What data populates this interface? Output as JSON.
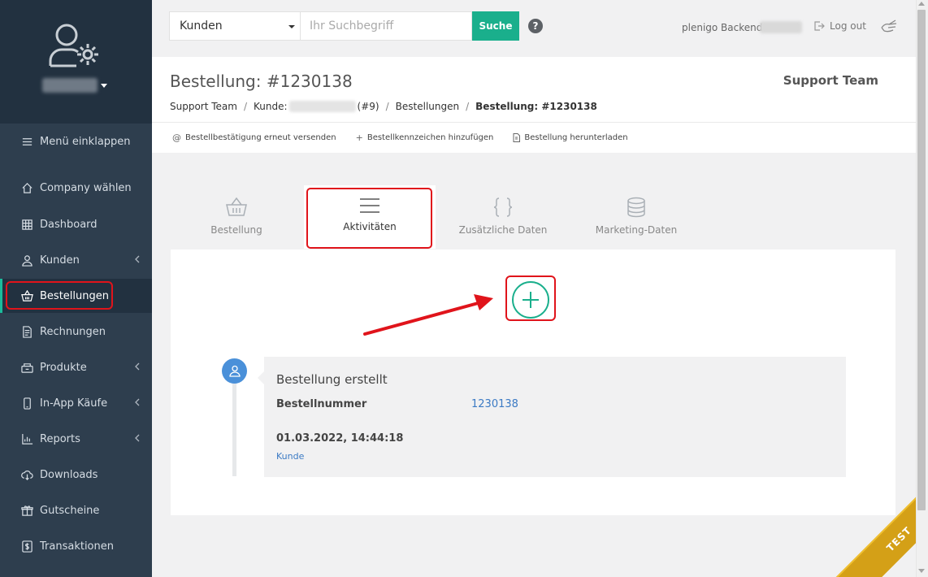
{
  "sidebar": {
    "collapse_label": "Menü einklappen",
    "items": [
      {
        "label": "Company wählen",
        "icon": "home-icon"
      },
      {
        "label": "Dashboard",
        "icon": "grid-icon"
      },
      {
        "label": "Kunden",
        "icon": "user-icon"
      },
      {
        "label": "Bestellungen",
        "icon": "basket-icon"
      },
      {
        "label": "Rechnungen",
        "icon": "document-icon"
      },
      {
        "label": "Produkte",
        "icon": "box-icon"
      },
      {
        "label": "In-App Käufe",
        "icon": "phone-icon"
      },
      {
        "label": "Reports",
        "icon": "bar-chart-icon"
      },
      {
        "label": "Downloads",
        "icon": "cloud-download-icon"
      },
      {
        "label": "Gutscheine",
        "icon": "gift-icon"
      },
      {
        "label": "Transaktionen",
        "icon": "dollar-icon"
      }
    ]
  },
  "topbar": {
    "search_scope": "Kunden",
    "search_placeholder": "Ihr Suchbegriff",
    "search_button": "Suche",
    "help": "?",
    "backend_label": "plenigo Backend",
    "logout_label": "Log out"
  },
  "header": {
    "title": "Bestellung: #1230138",
    "team": "Support Team",
    "breadcrumb": {
      "root": "Support Team",
      "customer_prefix": "Kunde:",
      "customer_suffix": "(#9)",
      "orders": "Bestellungen",
      "current": "Bestellung: #1230138"
    },
    "actions": [
      {
        "label": "Bestellbestätigung erneut versenden",
        "icon": "at-icon"
      },
      {
        "label": "Bestellkennzeichen hinzufügen",
        "icon": "plus-icon"
      },
      {
        "label": "Bestellung herunterladen",
        "icon": "file-icon"
      }
    ]
  },
  "tabs": [
    {
      "label": "Bestellung",
      "icon": "basket-icon"
    },
    {
      "label": "Aktivitäten",
      "icon": "list-icon"
    },
    {
      "label": "Zusätzliche Daten",
      "icon": "braces-icon"
    },
    {
      "label": "Marketing-Daten",
      "icon": "database-icon"
    }
  ],
  "activity": {
    "title": "Bestellung erstellt",
    "field_label": "Bestellnummer",
    "field_value": "1230138",
    "date": "01.03.2022, 14:44:18",
    "by": "Kunde"
  },
  "ribbon": "TEST",
  "colors": {
    "sidebar_bg": "#2e3e4e",
    "accent": "#1aaf8c",
    "highlight": "#e0141b",
    "link": "#3b7ac4",
    "ribbon": "#d4a017"
  }
}
